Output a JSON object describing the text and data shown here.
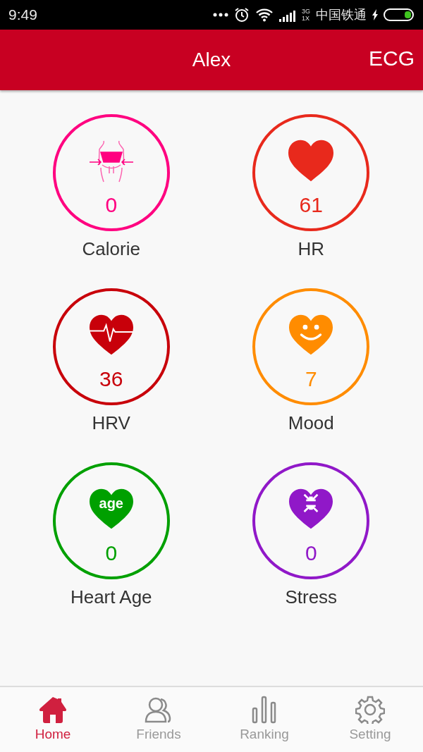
{
  "status_bar": {
    "time": "9:49",
    "network_top": "3G",
    "network_bottom": "1X",
    "carrier": "中国铁通"
  },
  "header": {
    "title": "Alex",
    "action": "ECG"
  },
  "metrics": [
    {
      "kind": "calorie",
      "label": "Calorie",
      "value": "0",
      "color": "#ff0080"
    },
    {
      "kind": "heart",
      "label": "HR",
      "value": "61",
      "color": "#e8291c"
    },
    {
      "kind": "hrv",
      "label": "HRV",
      "value": "36",
      "color": "#c8000a"
    },
    {
      "kind": "mood",
      "label": "Mood",
      "value": "7",
      "color": "#ff8c00"
    },
    {
      "kind": "age",
      "label": "Heart Age",
      "value": "0",
      "color": "#00a000",
      "icon_text": "age"
    },
    {
      "kind": "stress",
      "label": "Stress",
      "value": "0",
      "color": "#9018c8"
    }
  ],
  "nav": [
    {
      "kind": "home",
      "label": "Home",
      "selected": true
    },
    {
      "kind": "friends",
      "label": "Friends",
      "selected": false
    },
    {
      "kind": "ranking",
      "label": "Ranking",
      "selected": false
    },
    {
      "kind": "setting",
      "label": "Setting",
      "selected": false
    }
  ]
}
